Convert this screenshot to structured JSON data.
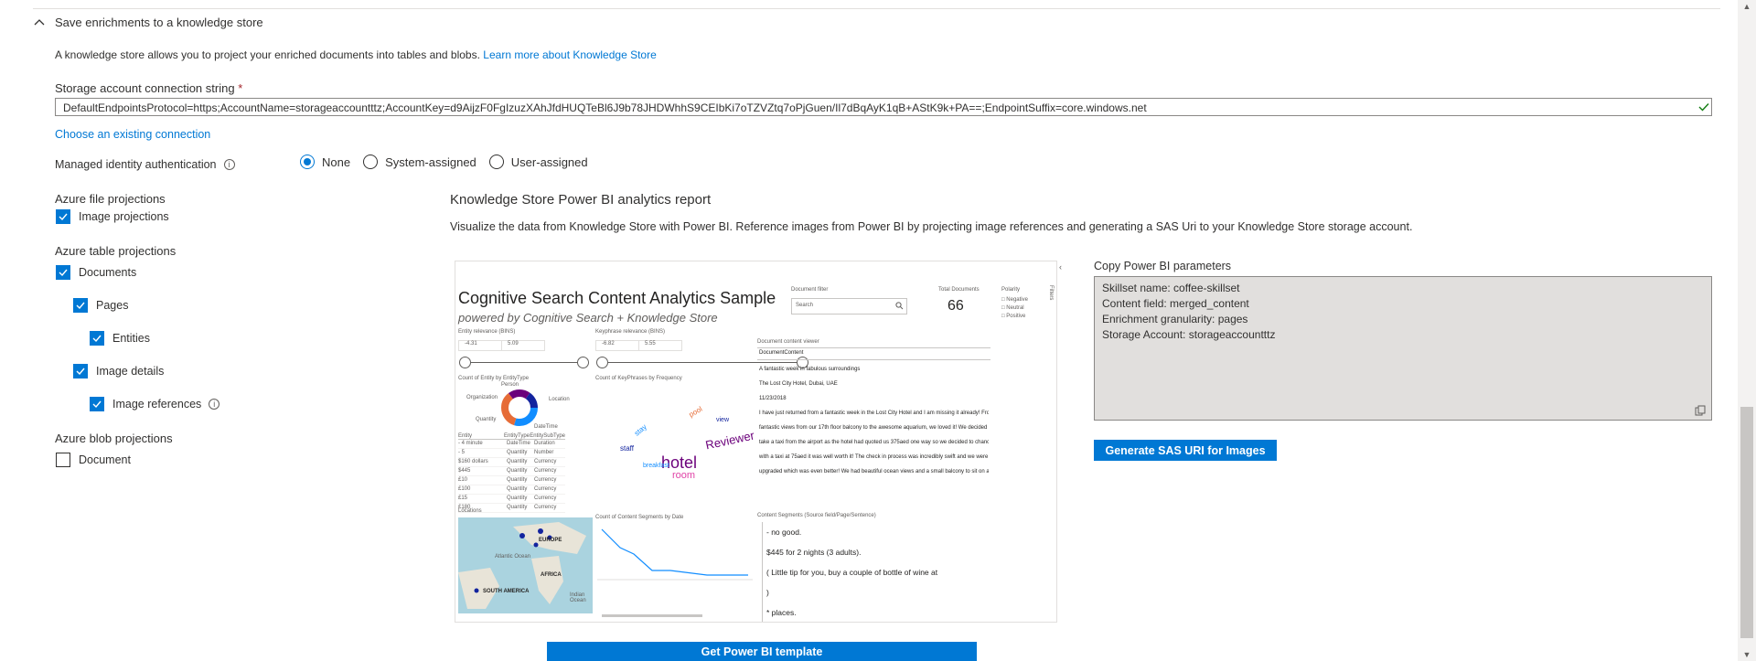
{
  "section": {
    "title": "Save enrichments to a knowledge store",
    "description": "A knowledge store allows you to project your enriched documents into tables and blobs.",
    "learn_more": "Learn more about Knowledge Store"
  },
  "connection": {
    "label": "Storage account connection string",
    "required_mark": "*",
    "value": "DefaultEndpointsProtocol=https;AccountName=storageaccountttz;AccountKey=d9AijzF0FgIzuzXAhJfdHUQTeBl6J9b78JHDWhhS9CEIbKi7oTZVZtq7oPjGuen/Il7dBqAyK1qB+AStK9k+PA==;EndpointSuffix=core.windows.net",
    "choose_existing": "Choose an existing connection"
  },
  "identity": {
    "label": "Managed identity authentication",
    "options": [
      "None",
      "System-assigned",
      "User-assigned"
    ],
    "selected": "None"
  },
  "projections": {
    "file_title": "Azure file projections",
    "file_items": [
      {
        "label": "Image projections",
        "checked": true
      }
    ],
    "table_title": "Azure table projections",
    "table_items": [
      {
        "label": "Documents",
        "checked": true
      },
      {
        "label": "Pages",
        "checked": true
      },
      {
        "label": "Entities",
        "checked": true
      },
      {
        "label": "Image details",
        "checked": true
      },
      {
        "label": "Image references",
        "checked": true
      }
    ],
    "blob_title": "Azure blob projections",
    "blob_items": [
      {
        "label": "Document",
        "checked": false
      }
    ]
  },
  "powerbi": {
    "title": "Knowledge Store Power BI analytics report",
    "description": "Visualize the data from Knowledge Store with Power BI. Reference images from Power BI by projecting image references and generating a SAS Uri to your Knowledge Store storage account.",
    "params_label": "Copy Power BI parameters",
    "params": [
      "Skillset name: coffee-skillset",
      "Content field: merged_content",
      "Enrichment granularity: pages",
      "Storage Account: storageaccountttz"
    ],
    "sas_button": "Generate SAS URI for Images",
    "template_button": "Get Power BI template"
  },
  "report": {
    "title": "Cognitive Search Content Analytics Sample",
    "subtitle": "powered by Cognitive Search + Knowledge Store",
    "doc_filter_label": "Document filter",
    "search_placeholder": "Search",
    "total_docs_label": "Total Documents",
    "total_docs": "66",
    "polarity_label": "Polarity",
    "polarity_options": [
      "Negative",
      "Neutral",
      "Positive"
    ],
    "entity_rel_label": "Entity relevance (BINS)",
    "entity_rel_min": "-4.31",
    "entity_rel_max": "5.09",
    "key_rel_label": "Keyphrase relevance (BINS)",
    "key_rel_min": "-6.82",
    "key_rel_max": "5.55",
    "doc_content_label": "Document content viewer",
    "doc_content_header": "DocumentContent",
    "doc_lines": [
      "A fantastic week in fabulous surroundings",
      "The Lost City Hotel, Dubai, UAE",
      "11/23/2018",
      "I have just returned from a fantastic week in the Lost City Hotel and I am missing it already! From the",
      "fantastic views from our 17th floor balcony to the awesome aquarium, we loved it! We decided to",
      "take a taxi from the airport as the hotel had quoted us 375aed one way so we decided to chance it",
      "with a taxi at 75aed it was well worth it! The check in process was incredibly swift and we were",
      "upgraded which was even better! We had beautiful ocean views and a small balcony to sit on and"
    ],
    "entity_chart_label": "Count of Entity by EntityType",
    "donut_labels": [
      "Person",
      "Organization",
      "Location",
      "Quantity",
      "DateTime"
    ],
    "keyphrase_chart_label": "Count of KeyPhrases by Frequency",
    "table_headers": [
      "Entity",
      "EntityType",
      "EntitySubType"
    ],
    "table_rows": [
      [
        "- 4 minute",
        "DateTime",
        "Duration"
      ],
      [
        "- 5",
        "Quantity",
        "Number"
      ],
      [
        "$160 dollars",
        "Quantity",
        "Currency"
      ],
      [
        "$445",
        "Quantity",
        "Currency"
      ],
      [
        "£10",
        "Quantity",
        "Currency"
      ],
      [
        "£100",
        "Quantity",
        "Currency"
      ],
      [
        "£15",
        "Quantity",
        "Currency"
      ],
      [
        "£180",
        "Quantity",
        "Currency"
      ]
    ],
    "locations_label": "Locations",
    "map_labels": [
      "EUROPE",
      "AFRICA",
      "SOUTH AMERICA",
      "Atlantic Ocean",
      "Indian Ocean"
    ],
    "segments_chart_label": "Count of Content Segments by Date",
    "segments_label": "Content Segments (Source field/Page/Sentence)",
    "segments": [
      "- no good.",
      "$445 for 2 nights (3 adults).",
      "( Little tip for you, buy a couple of bottle of wine at",
      ")",
      "* places."
    ],
    "word_cloud": [
      "hotel",
      "room",
      "Reviewer",
      "stay",
      "staff",
      "pool",
      "breakfast",
      "view"
    ],
    "filters_label": "Filters"
  },
  "colors": {
    "accent": "#0078d4",
    "donut": [
      "#118dff",
      "#12239e",
      "#e66c37",
      "#6b007b",
      "#e044a7"
    ]
  }
}
